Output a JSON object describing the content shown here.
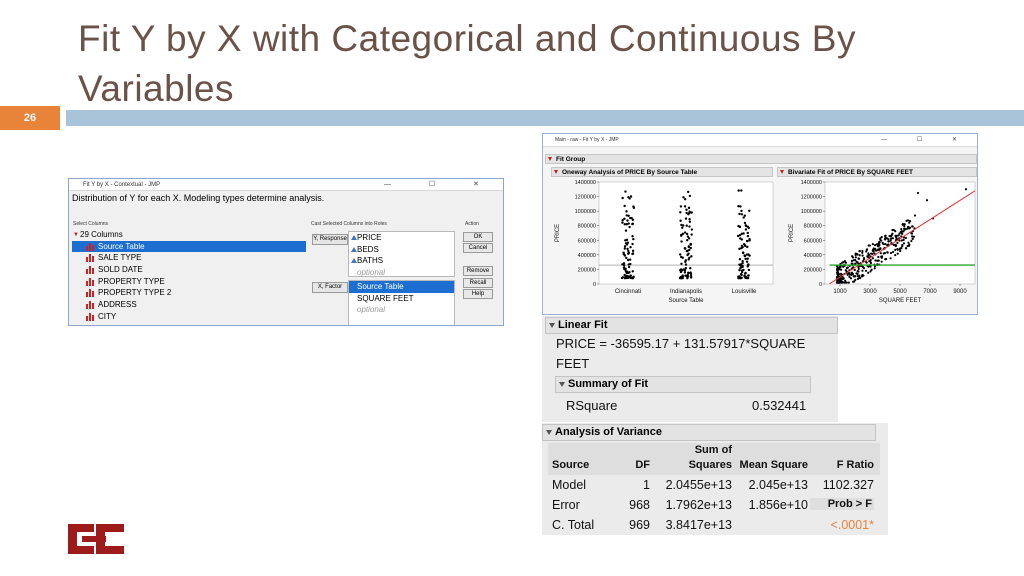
{
  "slide": {
    "title": "Fit Y by X with Categorical and Continuous By Variables",
    "number": "26",
    "accent": "#e8833a",
    "band_color": "#a9c4d9",
    "title_color": "#6b5249"
  },
  "dialog": {
    "window_title": "Fit Y by X - Contextual - JMP",
    "description": "Distribution of Y for each X. Modeling types determine analysis.",
    "select_columns_label": "Select Columns",
    "columns_count": "29 Columns",
    "columns": [
      "Source Table",
      "SALE TYPE",
      "SOLD DATE",
      "PROPERTY TYPE",
      "PROPERTY TYPE 2",
      "ADDRESS",
      "CITY"
    ],
    "selected_column": "Source Table",
    "cast_label": "Cast Selected Columns into Roles",
    "y_button": "Y, Response",
    "y_roles": [
      "PRICE",
      "BEDS",
      "BATHS"
    ],
    "optional": "optional",
    "x_button": "X, Factor",
    "x_roles": [
      "Source Table",
      "SQUARE FEET"
    ],
    "action_label": "Action",
    "actions": [
      "OK",
      "Cancel",
      "Remove",
      "Recall",
      "Help"
    ]
  },
  "report": {
    "window_title": "Main - raw - Fit Y by X - JMP",
    "fit_group": "Fit Group",
    "oneway_title": "Oneway Analysis of PRICE By Source Table",
    "bivariate_title": "Bivariate Fit of PRICE By SQUARE FEET",
    "y_label": "PRICE",
    "oneway_xlabel": "Source Table",
    "bivariate_xlabel": "SQUARE FEET"
  },
  "chart_data": [
    {
      "type": "scatter",
      "title": "Oneway Analysis of PRICE By Source Table",
      "xlabel": "Source Table",
      "ylabel": "PRICE",
      "categories": [
        "Cincinnati",
        "Indianapolis",
        "Louisville"
      ],
      "yticks": [
        "0",
        "200000",
        "400000",
        "600000",
        "800000",
        "1000000",
        "1200000",
        "1400000"
      ],
      "ylim": [
        0,
        1400000
      ],
      "reference_line": 260000
    },
    {
      "type": "scatter",
      "title": "Bivariate Fit of PRICE By SQUARE FEET",
      "xlabel": "SQUARE FEET",
      "ylabel": "PRICE",
      "xticks": [
        "1000",
        "3000",
        "5000",
        "7000",
        "9000"
      ],
      "yticks": [
        "0",
        "200000",
        "400000",
        "600000",
        "800000",
        "1000000",
        "1200000",
        "1400000"
      ],
      "xlim": [
        0,
        10000
      ],
      "ylim": [
        0,
        1400000
      ],
      "fit_line": {
        "intercept": -36595.17,
        "slope": 131.57917
      },
      "mean_line": 260000,
      "colors": {
        "fit": "#e0333a",
        "mean": "#2aa52a"
      }
    }
  ],
  "linear_fit": {
    "title": "Linear Fit",
    "equation_line1": "PRICE = -36595.17 + 131.57917*SQUARE",
    "equation_line2": "FEET"
  },
  "summary_of_fit": {
    "title": "Summary of Fit",
    "label": "RSquare",
    "value": "0.532441"
  },
  "anova": {
    "title": "Analysis of Variance",
    "headers": {
      "source": "Source",
      "df": "DF",
      "ss_1": "Sum of",
      "ss_2": "Squares",
      "ms": "Mean Square",
      "f": "F Ratio"
    },
    "rows": [
      {
        "source": "Model",
        "df": "1",
        "ss": "2.0455e+13",
        "ms": "2.045e+13",
        "f": "1102.327"
      },
      {
        "source": "Error",
        "df": "968",
        "ss": "1.7962e+13",
        "ms": "1.856e+10",
        "f": "Prob > F"
      },
      {
        "source": "C. Total",
        "df": "969",
        "ss": "3.8417e+13",
        "ms": "",
        "f": "<.0001*"
      }
    ],
    "prob_color": "#e8833a"
  }
}
